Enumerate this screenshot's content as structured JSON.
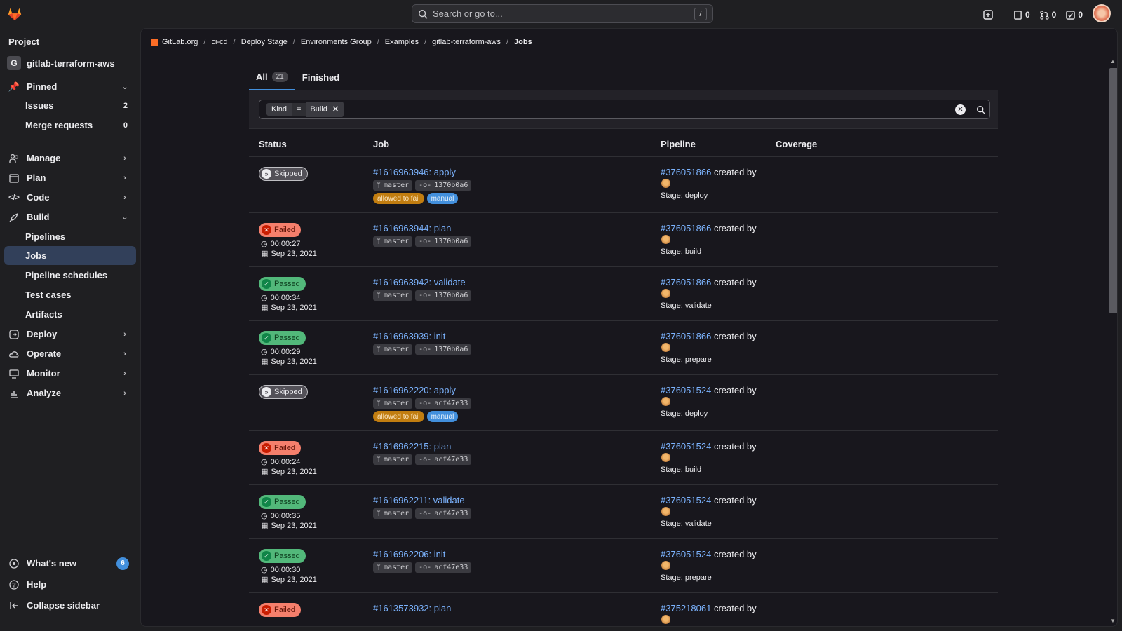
{
  "search": {
    "placeholder": "Search or go to...",
    "shortcut": "/"
  },
  "topbar": {
    "issues_count": "0",
    "mr_count": "0",
    "todo_count": "0"
  },
  "sidebar": {
    "section_title": "Project",
    "repo_initial": "G",
    "repo_name": "gitlab-terraform-aws",
    "pinned": "Pinned",
    "issues": "Issues",
    "issues_count": "2",
    "merge_requests": "Merge requests",
    "mr_count": "0",
    "manage": "Manage",
    "plan": "Plan",
    "code": "Code",
    "build": "Build",
    "pipelines": "Pipelines",
    "jobs": "Jobs",
    "pipeline_schedules": "Pipeline schedules",
    "test_cases": "Test cases",
    "artifacts": "Artifacts",
    "deploy": "Deploy",
    "operate": "Operate",
    "monitor": "Monitor",
    "analyze": "Analyze",
    "whats_new": "What's new",
    "whats_new_count": "6",
    "help": "Help",
    "collapse": "Collapse sidebar"
  },
  "breadcrumbs": [
    "GitLab.org",
    "ci-cd",
    "Deploy Stage",
    "Environments Group",
    "Examples",
    "gitlab-terraform-aws",
    "Jobs"
  ],
  "tabs": {
    "all": "All",
    "all_count": "21",
    "finished": "Finished"
  },
  "filter": {
    "token_key": "Kind",
    "token_op": "=",
    "token_value": "Build"
  },
  "table_headers": {
    "status": "Status",
    "job": "Job",
    "pipeline": "Pipeline",
    "coverage": "Coverage"
  },
  "jobs": [
    {
      "status": "Skipped",
      "status_kind": "skipped",
      "duration": "",
      "date": "",
      "job": "#1616963946: apply",
      "branch": "master",
      "commit": "1370b0a6",
      "labels": [
        "allowed to fail",
        "manual"
      ],
      "pipeline": "#376051866",
      "created_by": "created by",
      "stage": "Stage: deploy"
    },
    {
      "status": "Failed",
      "status_kind": "failed",
      "duration": "00:00:27",
      "date": "Sep 23, 2021",
      "job": "#1616963944: plan",
      "branch": "master",
      "commit": "1370b0a6",
      "labels": [],
      "pipeline": "#376051866",
      "created_by": "created by",
      "stage": "Stage: build"
    },
    {
      "status": "Passed",
      "status_kind": "passed",
      "duration": "00:00:34",
      "date": "Sep 23, 2021",
      "job": "#1616963942: validate",
      "branch": "master",
      "commit": "1370b0a6",
      "labels": [],
      "pipeline": "#376051866",
      "created_by": "created by",
      "stage": "Stage: validate"
    },
    {
      "status": "Passed",
      "status_kind": "passed",
      "duration": "00:00:29",
      "date": "Sep 23, 2021",
      "job": "#1616963939: init",
      "branch": "master",
      "commit": "1370b0a6",
      "labels": [],
      "pipeline": "#376051866",
      "created_by": "created by",
      "stage": "Stage: prepare"
    },
    {
      "status": "Skipped",
      "status_kind": "skipped",
      "duration": "",
      "date": "",
      "job": "#1616962220: apply",
      "branch": "master",
      "commit": "acf47e33",
      "labels": [
        "allowed to fail",
        "manual"
      ],
      "pipeline": "#376051524",
      "created_by": "created by",
      "stage": "Stage: deploy"
    },
    {
      "status": "Failed",
      "status_kind": "failed",
      "duration": "00:00:24",
      "date": "Sep 23, 2021",
      "job": "#1616962215: plan",
      "branch": "master",
      "commit": "acf47e33",
      "labels": [],
      "pipeline": "#376051524",
      "created_by": "created by",
      "stage": "Stage: build"
    },
    {
      "status": "Passed",
      "status_kind": "passed",
      "duration": "00:00:35",
      "date": "Sep 23, 2021",
      "job": "#1616962211: validate",
      "branch": "master",
      "commit": "acf47e33",
      "labels": [],
      "pipeline": "#376051524",
      "created_by": "created by",
      "stage": "Stage: validate"
    },
    {
      "status": "Passed",
      "status_kind": "passed",
      "duration": "00:00:30",
      "date": "Sep 23, 2021",
      "job": "#1616962206: init",
      "branch": "master",
      "commit": "acf47e33",
      "labels": [],
      "pipeline": "#376051524",
      "created_by": "created by",
      "stage": "Stage: prepare"
    },
    {
      "status": "Failed",
      "status_kind": "failed",
      "duration": "",
      "date": "",
      "job": "#1613573932: plan",
      "branch": "",
      "commit": "",
      "labels": [],
      "pipeline": "#375218061",
      "created_by": "created by",
      "stage": ""
    }
  ],
  "colors": {
    "accent": "#428fdc",
    "link": "#7cb4ff",
    "failed": "#f57f6c",
    "passed": "#52b87a",
    "skipped": "#535158",
    "allowed_to_fail": "#c17d10"
  }
}
